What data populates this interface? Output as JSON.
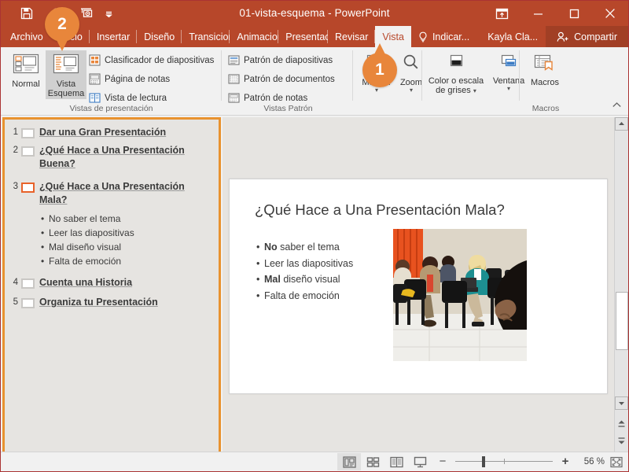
{
  "window": {
    "title": "01-vista-esquema  -  PowerPoint",
    "quick_access": [
      {
        "name": "save-icon",
        "label": "Guardar"
      },
      {
        "name": "undo-icon",
        "label": "Deshacer"
      },
      {
        "name": "start-presentation-icon",
        "label": "Comenzar presentación"
      },
      {
        "name": "customize-quick-access-icon",
        "label": "Personalizar barra de herramientas de acceso rápido"
      }
    ],
    "controls": [
      {
        "name": "ribbon-display-options-icon",
        "label": "Opciones de presentación de la cinta de opciones"
      },
      {
        "name": "minimize-button",
        "label": "Minimizar"
      },
      {
        "name": "maximize-button",
        "label": "Maximizar"
      },
      {
        "name": "close-button",
        "label": "Cerrar"
      }
    ]
  },
  "tabs": [
    {
      "label": "Archivo",
      "active": false
    },
    {
      "label": "Inicio",
      "active": false
    },
    {
      "label": "Insertar",
      "active": false
    },
    {
      "label": "Diseño",
      "active": false
    },
    {
      "label": "Transiciones",
      "active": false
    },
    {
      "label": "Animaciones",
      "active": false
    },
    {
      "label": "Presentación",
      "active": false
    },
    {
      "label": "Revisar",
      "active": false
    },
    {
      "label": "Vista",
      "active": true
    }
  ],
  "tab_right": {
    "tell_me": "Indicar...",
    "account": "Kayla Cla...",
    "share": "Compartir"
  },
  "ribbon": {
    "groups": [
      {
        "label": "Vistas de presentación",
        "big_buttons": [
          {
            "label_line1": "Normal",
            "label_line2": "",
            "icon": "normal-view-icon",
            "selected": false
          },
          {
            "label_line1": "Vista",
            "label_line2": "Esquema",
            "icon": "outline-view-icon",
            "selected": true
          }
        ],
        "small_buttons": [
          {
            "label": "Clasificador de diapositivas",
            "icon": "slide-sorter-icon"
          },
          {
            "label": "Página de notas",
            "icon": "notes-page-icon"
          },
          {
            "label": "Vista de lectura",
            "icon": "reading-view-icon"
          }
        ]
      },
      {
        "label": "Vistas Patrón",
        "big_buttons": [],
        "small_buttons": [
          {
            "label": "Patrón de diapositivas",
            "icon": "slide-master-icon"
          },
          {
            "label": "Patrón de documentos",
            "icon": "handout-master-icon"
          },
          {
            "label": "Patrón de notas",
            "icon": "notes-master-icon"
          }
        ]
      },
      {
        "label": "",
        "big_buttons": [
          {
            "label_line1": "Mostrar",
            "label_line2": "",
            "icon": "show-icon",
            "selected": false,
            "has_caret": true
          },
          {
            "label_line1": "Zoom",
            "label_line2": "",
            "icon": "zoom-icon",
            "selected": false,
            "has_caret": true
          }
        ],
        "small_buttons": []
      },
      {
        "label": "",
        "big_buttons": [
          {
            "label_line1": "Color o escala",
            "label_line2": "de grises",
            "icon": "color-grayscale-icon",
            "selected": false,
            "has_caret": true
          },
          {
            "label_line1": "Ventana",
            "label_line2": "",
            "icon": "window-icon",
            "selected": false,
            "has_caret": true
          }
        ],
        "small_buttons": []
      },
      {
        "label": "Macros",
        "big_buttons": [
          {
            "label_line1": "Macros",
            "label_line2": "",
            "icon": "macros-icon",
            "selected": false,
            "has_caret": false
          }
        ],
        "small_buttons": []
      }
    ],
    "collapse_label": "Contraer la cinta de opciones"
  },
  "outline": {
    "slides": [
      {
        "number": "1",
        "title": "Dar una Gran Presentación",
        "selected": false,
        "bullets": []
      },
      {
        "number": "2",
        "title": "¿Qué Hace a Una Presentación Buena?",
        "selected": false,
        "bullets": []
      },
      {
        "number": "3",
        "title": "¿Qué Hace a Una Presentación Mala?",
        "selected": true,
        "bullets": [
          "No saber el tema",
          "Leer las diapositivas",
          "Mal diseño visual",
          "Falta de emoción"
        ]
      },
      {
        "number": "4",
        "title": "Cuenta una Historia",
        "selected": false,
        "bullets": []
      },
      {
        "number": "5",
        "title": "Organiza tu Presentación",
        "selected": false,
        "bullets": []
      }
    ]
  },
  "slide": {
    "title": "¿Qué Hace a Una Presentación Mala?",
    "bullets": [
      {
        "bold": "No",
        "rest": " saber el tema"
      },
      {
        "bold": "",
        "rest": "Leer las diapositivas"
      },
      {
        "bold": "Mal",
        "rest": " diseño visual"
      },
      {
        "bold": "",
        "rest": "Falta de emoción"
      }
    ],
    "image_alt": "Audiencia aburrida sentada en sillas"
  },
  "status_bar": {
    "view_buttons": [
      {
        "name": "normal-view-button",
        "label": "Normal",
        "active": true
      },
      {
        "name": "slide-sorter-button",
        "label": "Clasificador de diapositivas",
        "active": false
      },
      {
        "name": "reading-view-button",
        "label": "Vista de lectura",
        "active": false
      },
      {
        "name": "slideshow-button",
        "label": "Presentación con diapositivas",
        "active": false
      }
    ],
    "zoom_out_label": "−",
    "zoom_in_label": "+",
    "zoom_percent": "56 %",
    "fit_label": "Ajustar diapositiva a la ventana actual"
  },
  "scrollbar": {
    "up_label": "Desplazar hacia arriba",
    "down_label": "Desplazar hacia abajo",
    "prev_slide_label": "Diapositiva anterior",
    "next_slide_label": "Diapositiva siguiente"
  },
  "callouts": [
    {
      "number": "1"
    },
    {
      "number": "2"
    }
  ],
  "colors": {
    "ribbon_red": "#b7472a",
    "accent_orange": "#e8863b",
    "outline_border": "#e8922f",
    "selection_orange": "#e8622a"
  }
}
